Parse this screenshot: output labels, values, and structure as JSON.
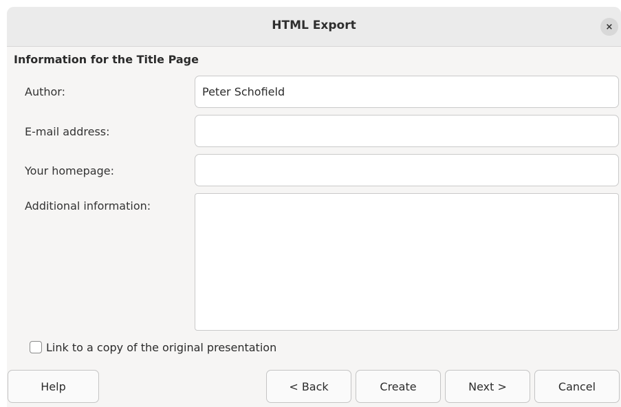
{
  "window": {
    "title": "HTML Export",
    "close_icon": "close-icon",
    "close_glyph": "×"
  },
  "section": {
    "heading": "Information for the Title Page"
  },
  "fields": {
    "author_label": "Author:",
    "author_value": "Peter Schofield",
    "email_label": "E-mail address:",
    "email_value": "",
    "homepage_label": "Your homepage:",
    "homepage_value": "",
    "additional_label": "Additional information:",
    "additional_value": ""
  },
  "checkbox": {
    "label": "Link to a copy of the original presentation",
    "checked": false
  },
  "buttons": {
    "help": "Help",
    "back": "< Back",
    "create": "Create",
    "next": "Next >",
    "cancel": "Cancel"
  }
}
